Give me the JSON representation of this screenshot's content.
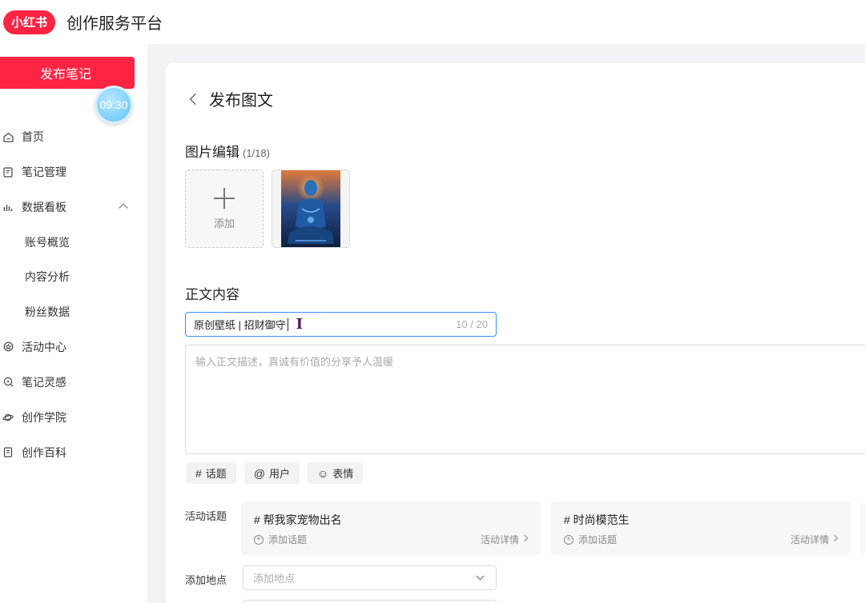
{
  "header": {
    "logo_text": "小红书",
    "app_title": "创作服务平台",
    "brand_color": "#ff2442"
  },
  "sidebar": {
    "publish_label": "发布笔记",
    "timer": "09:30",
    "items": [
      {
        "label": "首页",
        "icon": "home-icon"
      },
      {
        "label": "笔记管理",
        "icon": "note-icon"
      },
      {
        "label": "数据看板",
        "icon": "bar-chart-icon",
        "expanded": true
      },
      {
        "label": "账号概览"
      },
      {
        "label": "内容分析"
      },
      {
        "label": "粉丝数据"
      },
      {
        "label": "活动中心",
        "icon": "activity-icon"
      },
      {
        "label": "笔记灵感",
        "icon": "inspiration-icon"
      },
      {
        "label": "创作学院",
        "icon": "planet-icon"
      },
      {
        "label": "创作百科",
        "icon": "book-icon"
      }
    ]
  },
  "page": {
    "back_title": "发布图文",
    "image_section": {
      "title": "图片编辑",
      "count": "(1/18)",
      "add_label": "添加"
    },
    "content_section": {
      "title": "正文内容"
    },
    "title_input": {
      "value": "原创壁纸 | 招财御守",
      "counter": "10 / 20"
    },
    "body_placeholder": "输入正文描述，真诚有价值的分享予人温暖",
    "chips": [
      {
        "icon": "#",
        "label": "话题"
      },
      {
        "icon": "@",
        "label": "用户"
      },
      {
        "icon": "☺",
        "label": "表情"
      }
    ],
    "activity": {
      "label": "活动话题",
      "cards": [
        {
          "name": "# 帮我家宠物出名",
          "add": "添加话题",
          "detail": "活动详情"
        },
        {
          "name": "# 时尚模范生",
          "add": "添加话题",
          "detail": "活动详情"
        }
      ]
    },
    "location": {
      "label": "添加地点",
      "placeholder": "添加地点"
    }
  }
}
